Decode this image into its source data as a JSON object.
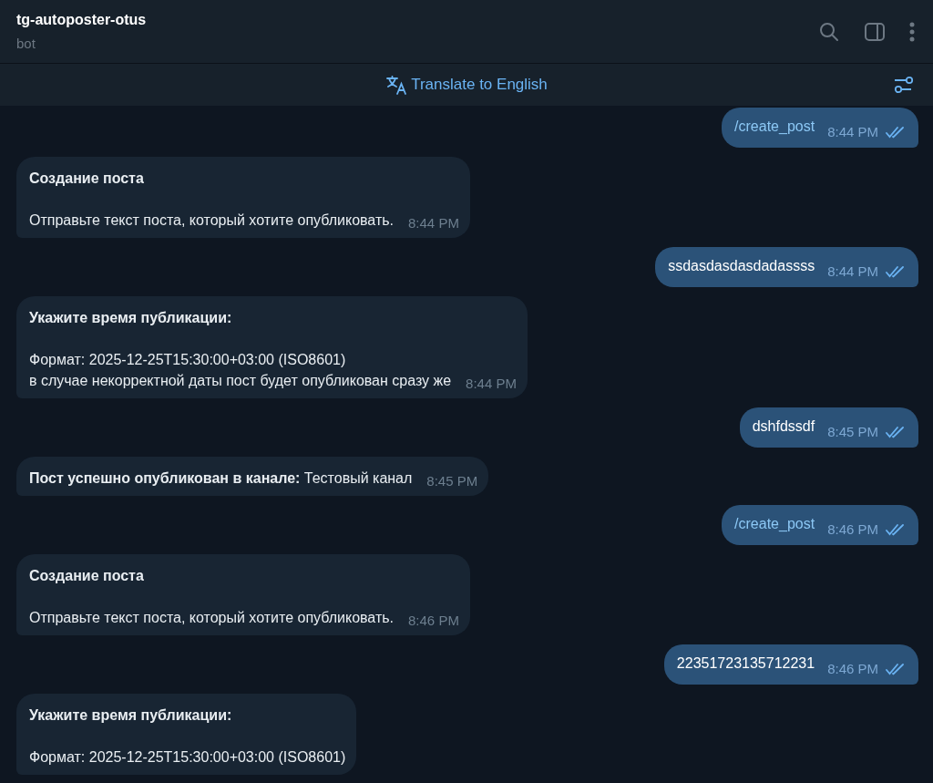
{
  "chat": {
    "title": "tg-autoposter-otus",
    "subtitle": "bot"
  },
  "translate_bar": {
    "label": "Translate to English"
  },
  "messages": [
    {
      "kind": "outgoing",
      "command": true,
      "text": "/create_post",
      "time": "8:44 PM",
      "read": true
    },
    {
      "kind": "incoming",
      "paragraphs": [
        "**Создание поста**",
        "Отправьте текст поста, который хотите опубликовать."
      ],
      "time": "8:44 PM"
    },
    {
      "kind": "outgoing",
      "command": false,
      "text": "ssdasdasdasdadassss",
      "time": "8:44 PM",
      "read": true
    },
    {
      "kind": "incoming",
      "paragraphs": [
        "**Укажите время публикации:**",
        "Формат: 2025-12-25T15:30:00+03:00 (ISO8601)\nв случае некорректной даты пост будет опубликован сразу же"
      ],
      "time": "8:44 PM"
    },
    {
      "kind": "outgoing",
      "command": false,
      "text": "dshfdssdf",
      "time": "8:45 PM",
      "read": true
    },
    {
      "kind": "incoming",
      "paragraphs": [
        "**Пост успешно опубликован в канале:** Тестовый канал"
      ],
      "time": "8:45 PM"
    },
    {
      "kind": "outgoing",
      "command": true,
      "text": "/create_post",
      "time": "8:46 PM",
      "read": true
    },
    {
      "kind": "incoming",
      "paragraphs": [
        "**Создание поста**",
        "Отправьте текст поста, который хотите опубликовать."
      ],
      "time": "8:46 PM"
    },
    {
      "kind": "outgoing",
      "command": false,
      "text": "22351723135712231",
      "time": "8:46 PM",
      "read": true
    },
    {
      "kind": "incoming",
      "paragraphs": [
        "**Укажите время публикации:**",
        "Формат: 2025-12-25T15:30:00+03:00 (ISO8601)"
      ]
    }
  ]
}
